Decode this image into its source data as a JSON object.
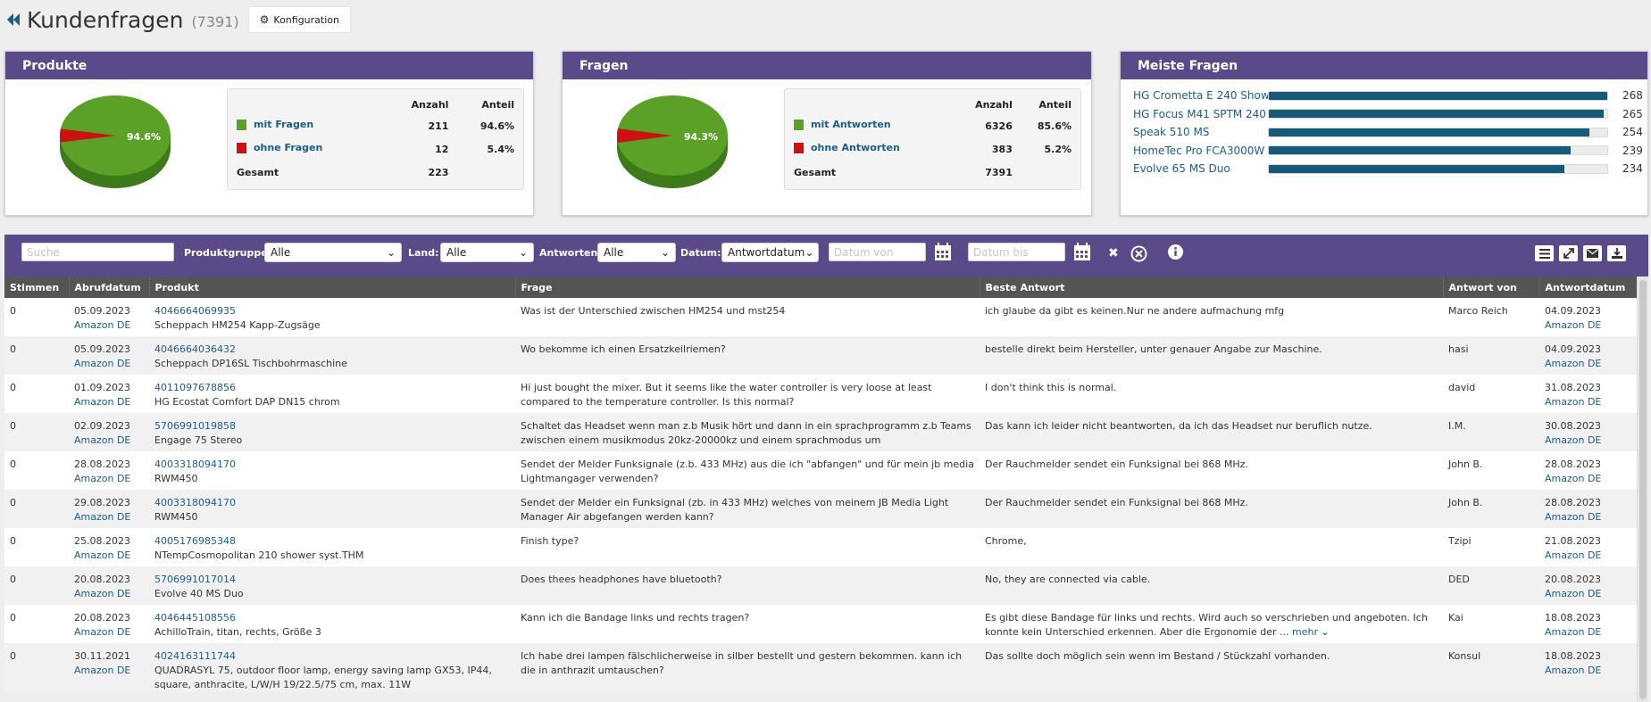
{
  "header": {
    "title": "Kundenfragen",
    "count": "(7391)",
    "config_label": "Konfiguration"
  },
  "widgets": {
    "products": {
      "title": "Produkte",
      "pie_label": "94.6%",
      "col_count": "Anzahl",
      "col_share": "Anteil",
      "rows": [
        {
          "label": "mit Fragen",
          "count": "211",
          "share": "94.6%",
          "color": "#5ba128"
        },
        {
          "label": "ohne Fragen",
          "count": "12",
          "share": "5.4%",
          "color": "#cc1111"
        }
      ],
      "total_label": "Gesamt",
      "total_count": "223",
      "pie_values": [
        94.6,
        5.4
      ]
    },
    "questions": {
      "title": "Fragen",
      "pie_label": "94.3%",
      "col_count": "Anzahl",
      "col_share": "Anteil",
      "rows": [
        {
          "label": "mit Antworten",
          "count": "6326",
          "share": "85.6%",
          "color": "#5ba128"
        },
        {
          "label": "ohne Antworten",
          "count": "383",
          "share": "5.2%",
          "color": "#cc1111"
        }
      ],
      "total_label": "Gesamt",
      "total_count": "7391",
      "pie_values": [
        94.3,
        5.7
      ]
    },
    "top": {
      "title": "Meiste Fragen",
      "max": 268,
      "items": [
        {
          "name": "HG Crometta E 240 Show",
          "value": 268
        },
        {
          "name": "HG Focus M41 SPTM 240",
          "value": 265
        },
        {
          "name": "Speak 510 MS",
          "value": 254
        },
        {
          "name": "HomeTec Pro FCA3000W",
          "value": 239
        },
        {
          "name": "Evolve 65 MS Duo",
          "value": 234
        }
      ]
    }
  },
  "filters": {
    "search_placeholder": "Suche",
    "product_group_label": "Produktgruppe:",
    "product_group_value": "Alle",
    "country_label": "Land:",
    "country_value": "Alle",
    "answers_label": "Antworten:",
    "answers_value": "Alle",
    "date_label": "Datum:",
    "date_value": "Antwortdatum",
    "date_from_placeholder": "Datum von",
    "date_to_placeholder": "Datum bis"
  },
  "table": {
    "columns": [
      "Stimmen",
      "Abrufdatum",
      "Produkt",
      "Frage",
      "Beste Antwort",
      "Antwort von",
      "Antwortdatum"
    ],
    "more_label": "mehr",
    "rows": [
      {
        "votes": "0",
        "fetch_date": "05.09.2023",
        "fetch_source": "Amazon DE",
        "ean": "4046664069935",
        "product": "Scheppach HM254 Kapp-Zugsäge",
        "question": "Was ist der Unterschied zwischen HM254 und mst254",
        "answer": "ich glaube da gibt es keinen.Nur ne andere aufmachung mfg",
        "author": "Marco Reich",
        "answer_date": "04.09.2023",
        "answer_source": "Amazon DE"
      },
      {
        "votes": "0",
        "fetch_date": "05.09.2023",
        "fetch_source": "Amazon DE",
        "ean": "4046664036432",
        "product": "Scheppach DP16SL Tischbohrmaschine",
        "question": "Wo bekomme ich einen Ersatzkeilriemen?",
        "answer": "bestelle direkt beim Hersteller, unter genauer Angabe zur Maschine.",
        "author": "hasi",
        "answer_date": "04.09.2023",
        "answer_source": "Amazon DE"
      },
      {
        "votes": "0",
        "fetch_date": "01.09.2023",
        "fetch_source": "Amazon DE",
        "ean": "4011097678856",
        "product": "HG Ecostat Comfort DAP DN15 chrom",
        "question": "Hi just bought the mixer. But it seems like the water controller is very loose at least compared to the temperature controller. Is this normal?",
        "answer": "I don't think this is normal.",
        "author": "david",
        "answer_date": "31.08.2023",
        "answer_source": "Amazon DE"
      },
      {
        "votes": "0",
        "fetch_date": "02.09.2023",
        "fetch_source": "Amazon DE",
        "ean": "5706991019858",
        "product": "Engage 75 Stereo",
        "question": "Schaltet das Headset wenn man z.b Musik hört und dann in ein sprachprogramm z.b Teams zwischen einem musikmodus 20kz-20000kz und einem sprachmodus um",
        "answer": "Das kann ich leider nicht beantworten, da ich das Headset nur beruflich nutze.",
        "author": "I.M.",
        "answer_date": "30.08.2023",
        "answer_source": "Amazon DE"
      },
      {
        "votes": "0",
        "fetch_date": "28.08.2023",
        "fetch_source": "Amazon DE",
        "ean": "4003318094170",
        "product": "RWM450",
        "question": "Sendet der Melder Funksignale (z.b. 433 MHz) aus die ich \"abfangen\" und für mein jb media Lightmangager verwenden?",
        "answer": "Der Rauchmelder sendet ein Funksignal bei 868 MHz.",
        "author": "John B.",
        "answer_date": "28.08.2023",
        "answer_source": "Amazon DE"
      },
      {
        "votes": "0",
        "fetch_date": "29.08.2023",
        "fetch_source": "Amazon DE",
        "ean": "4003318094170",
        "product": "RWM450",
        "question": "Sendet der Melder ein Funksignal (zb. in 433 MHz) welches von meinem JB Media Light Manager Air abgefangen werden kann?",
        "answer": "Der Rauchmelder sendet ein Funksignal bei 868 MHz.",
        "author": "John B.",
        "answer_date": "28.08.2023",
        "answer_source": "Amazon DE"
      },
      {
        "votes": "0",
        "fetch_date": "25.08.2023",
        "fetch_source": "Amazon DE",
        "ean": "4005176985348",
        "product": "NTempCosmopolitan 210 shower syst.THM",
        "question": "Finish type?",
        "answer": "Chrome,",
        "author": "Tzipi",
        "answer_date": "21.08.2023",
        "answer_source": "Amazon DE"
      },
      {
        "votes": "0",
        "fetch_date": "20.08.2023",
        "fetch_source": "Amazon DE",
        "ean": "5706991017014",
        "product": "Evolve 40 MS Duo",
        "question": "Does thees headphones have bluetooth?",
        "answer": "No, they are connected via cable.",
        "author": "DED",
        "answer_date": "20.08.2023",
        "answer_source": "Amazon DE"
      },
      {
        "votes": "0",
        "fetch_date": "20.08.2023",
        "fetch_source": "Amazon DE",
        "ean": "4046445108556",
        "product": "AchilloTrain, titan, rechts, Größe 3",
        "question": "Kann ich die Bandage links und rechts tragen?",
        "answer": "Es gibt diese Bandage für links und rechts. Wird auch so verschrieben und angeboten. Ich konnte kein Unterschied erkennen. Aber die Ergonomie der ...",
        "author": "Kai",
        "answer_date": "18.08.2023",
        "answer_source": "Amazon DE",
        "has_more": true
      },
      {
        "votes": "0",
        "fetch_date": "30.11.2021",
        "fetch_source": "Amazon DE",
        "ean": "4024163111744",
        "product": "QUADRASYL 75, outdoor floor lamp, energy saving lamp GX53, IP44, square, anthracite, L/W/H 19/22.5/75 cm, max. 11W",
        "question": "Ich habe drei lampen fälschlicherweise in silber bestellt und gestern bekommen. kann ich die in anthrazit umtauschen?",
        "answer": "Das sollte doch möglich sein wenn im Bestand / Stückzahl vorhanden.",
        "author": "Konsul",
        "answer_date": "18.08.2023",
        "answer_source": "Amazon DE"
      }
    ]
  }
}
